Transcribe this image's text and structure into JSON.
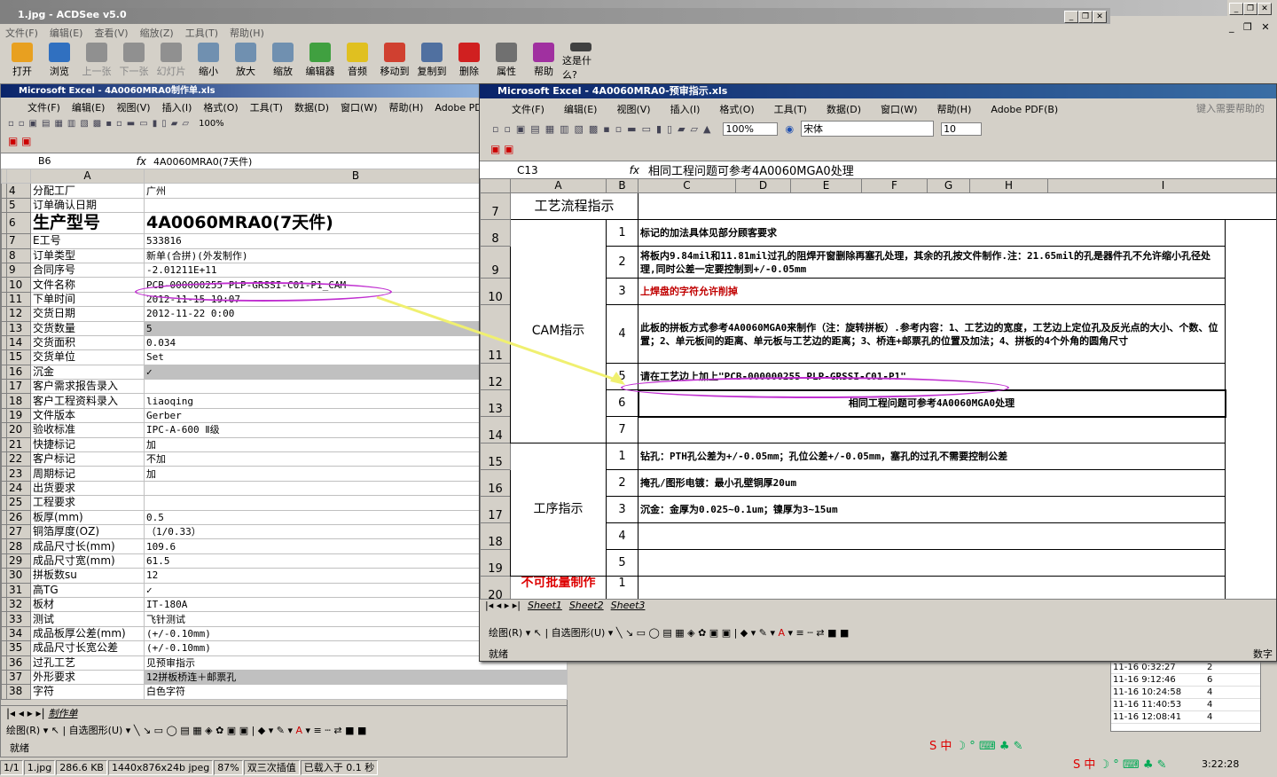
{
  "acdsee": {
    "title": "1.jpg - ACDSee v5.0",
    "menu": [
      "文件(F)",
      "编辑(E)",
      "查看(V)",
      "缩放(Z)",
      "工具(T)",
      "帮助(H)"
    ],
    "tools": [
      "打开",
      "浏览",
      "上一张",
      "下一张",
      "幻灯片",
      "缩小",
      "放大",
      "缩放",
      "编辑器",
      "音频",
      "移动到",
      "复制到",
      "删除",
      "属性",
      "帮助",
      "这是什么?"
    ],
    "status": [
      "1/1",
      "1.jpg",
      "286.6 KB",
      "1440x876x24b jpeg",
      "87%",
      "双三次插值",
      "已载入于 0.1 秒"
    ]
  },
  "excel1": {
    "title": "Microsoft Excel - 4A0060MRA0制作单.xls",
    "menu": [
      "文件(F)",
      "编辑(E)",
      "视图(V)",
      "插入(I)",
      "格式(O)",
      "工具(T)",
      "数据(D)",
      "窗口(W)",
      "帮助(H)",
      "Adobe PDF(B)"
    ],
    "zoom": "100%",
    "namebox": "B6",
    "formula": "4A0060MRA0(7天件)",
    "cols": [
      "A",
      "B"
    ],
    "rows": [
      [
        "4",
        "分配工厂",
        "广州"
      ],
      [
        "5",
        "订单确认日期",
        ""
      ],
      [
        "6",
        "生产型号",
        "4A0060MRA0(7天件)"
      ],
      [
        "7",
        "E工号",
        "533816"
      ],
      [
        "8",
        "订单类型",
        "新单(合拼)(外发制作)"
      ],
      [
        "9",
        "合同序号",
        "-2.01211E+11"
      ],
      [
        "10",
        "文件名称",
        "PCB-000000255 PLP-GRSSI-C01-P1_CAM"
      ],
      [
        "11",
        "下单时间",
        "2012-11-15 19:07"
      ],
      [
        "12",
        "交货日期",
        "2012-11-22 0:00"
      ],
      [
        "13",
        "交货数量",
        "5"
      ],
      [
        "14",
        "交货面积",
        "0.034"
      ],
      [
        "15",
        "交货单位",
        "Set"
      ],
      [
        "16",
        "沉金",
        "✓"
      ],
      [
        "17",
        "客户需求报告录入",
        ""
      ],
      [
        "18",
        "客户工程资料录入",
        "liaoqing"
      ],
      [
        "19",
        "文件版本",
        "Gerber"
      ],
      [
        "20",
        "验收标准",
        "IPC-A-600 Ⅱ级"
      ],
      [
        "21",
        "快捷标记",
        "加"
      ],
      [
        "22",
        "客户标记",
        "不加"
      ],
      [
        "23",
        "周期标记",
        "加"
      ],
      [
        "24",
        "出货要求",
        ""
      ],
      [
        "25",
        "工程要求",
        ""
      ],
      [
        "26",
        "板厚(mm)",
        "0.5"
      ],
      [
        "27",
        "铜箔厚度(OZ)",
        "（1/0.33）"
      ],
      [
        "28",
        "成品尺寸长(mm)",
        "109.6"
      ],
      [
        "29",
        "成品尺寸宽(mm)",
        "61.5"
      ],
      [
        "30",
        "拼板数su",
        "12"
      ],
      [
        "31",
        "高TG",
        "✓"
      ],
      [
        "32",
        "板材",
        "IT-180A"
      ],
      [
        "33",
        "测试",
        "飞针测试"
      ],
      [
        "34",
        "成品板厚公差(mm)",
        "(+/-0.10mm)"
      ],
      [
        "35",
        "成品尺寸长宽公差",
        "(+/-0.10mm)"
      ],
      [
        "36",
        "过孔工艺",
        "见预审指示"
      ],
      [
        "37",
        "外形要求",
        "12拼板桥连＋邮票孔"
      ],
      [
        "38",
        "字符",
        "白色字符"
      ]
    ],
    "sheet_tab": "制作单",
    "draw": "绘图(R)",
    "autoshape": "自选图形(U)",
    "status": "就绪"
  },
  "excel2": {
    "title": "Microsoft Excel - 4A0060MRA0-预审指示.xls",
    "menu": [
      "文件(F)",
      "编辑(E)",
      "视图(V)",
      "插入(I)",
      "格式(O)",
      "工具(T)",
      "数据(D)",
      "窗口(W)",
      "帮助(H)",
      "Adobe PDF(B)"
    ],
    "help_placeholder": "键入需要帮助的",
    "zoom": "100%",
    "font": "宋体",
    "size": "10",
    "namebox": "C13",
    "formula": "相同工程问题可参考4A0060MGA0处理",
    "cols": [
      "A",
      "B",
      "C",
      "D",
      "E",
      "F",
      "G",
      "H",
      "I"
    ],
    "row_nums": [
      "7",
      "8",
      "9",
      "10",
      "11",
      "12",
      "13",
      "14",
      "15",
      "16",
      "17",
      "18",
      "19",
      "20"
    ],
    "header_row": "工艺流程指示",
    "cam_label": "CAM指示",
    "cam_items": [
      [
        "1",
        "标记的加法具体见部分顾客要求"
      ],
      [
        "2",
        "将板内9.84mil和11.81mil过孔的阻焊开窗删除再塞孔处理，其余的孔按文件制作.注：21.65mil的孔是器件孔不允许缩小孔径处理,同时公差一定要控制到+/-0.05mm"
      ],
      [
        "3",
        "上焊盘的字符允许削掉"
      ],
      [
        "4",
        "此板的拼板方式参考4A0060MGA0来制作（注：旋转拼板）.参考内容：1、工艺边的宽度，工艺边上定位孔及反光点的大小、个数、位置；2、单元板间的距离、单元板与工艺边的距离；3、桥连+邮票孔的位置及加法；4、拼板的4个外角的圆角尺寸"
      ],
      [
        "5",
        "请在工艺边上加上\"PCB-000000255 PLP-GRSSI-C01-P1\""
      ],
      [
        "6",
        "相同工程问题可参考4A0060MGA0处理"
      ],
      [
        "7",
        ""
      ]
    ],
    "proc_label": "工序指示",
    "proc_items": [
      [
        "1",
        "钻孔：PTH孔公差为+/-0.05mm；孔位公差+/-0.05mm，塞孔的过孔不需要控制公差"
      ],
      [
        "2",
        "掩孔/图形电镀：最小孔壁铜厚20um"
      ],
      [
        "3",
        "沉金：金厚为0.025~0.1um；镍厚为3~15um"
      ],
      [
        "4",
        ""
      ],
      [
        "5",
        ""
      ]
    ],
    "last_label": "不可批量制作",
    "last_num": "1",
    "tabs": [
      "Sheet1",
      "Sheet2",
      "Sheet3"
    ],
    "draw": "绘图(R)",
    "autoshape": "自选图形(U)",
    "status": "就绪",
    "num": "数字"
  },
  "bg_rows": [
    [
      "11-16 0:32:27",
      "2"
    ],
    [
      "11-16 9:12:46",
      "6"
    ],
    [
      "11-16 10:24:58",
      "4"
    ],
    [
      "11-16 11:40:53",
      "4"
    ],
    [
      "11-16 12:08:41",
      "4"
    ]
  ],
  "clock": "3:22:28",
  "ime": "S 中"
}
